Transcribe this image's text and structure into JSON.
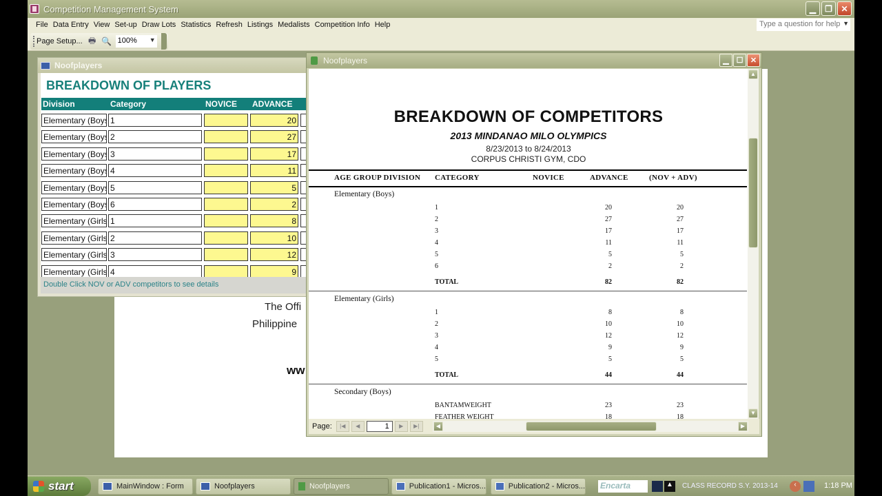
{
  "window": {
    "title": "Competition Management System",
    "controls": [
      "minimize",
      "restore",
      "close"
    ]
  },
  "menu": {
    "items": [
      "File",
      "Data Entry",
      "View",
      "Set-up",
      "Draw Lots",
      "Statistics",
      "Refresh",
      "Listings",
      "Medalists",
      "Competition Info",
      "Help"
    ],
    "help_placeholder": "Type a question for help"
  },
  "toolbar": {
    "page_setup_label": "Page Setup...",
    "zoom_value": "100%"
  },
  "background_page": {
    "line1": "The Offi",
    "line2": "Philippine",
    "line3": "ww"
  },
  "form_window": {
    "title": "Noofplayers",
    "heading": "BREAKDOWN OF PLAYERS",
    "columns": [
      "Division",
      "Category",
      "NOVICE",
      "ADVANCE"
    ],
    "rows": [
      {
        "division": "Elementary (Boys)",
        "category": "1",
        "novice": "",
        "advance": "20"
      },
      {
        "division": "Elementary (Boys)",
        "category": "2",
        "novice": "",
        "advance": "27"
      },
      {
        "division": "Elementary (Boys)",
        "category": "3",
        "novice": "",
        "advance": "17"
      },
      {
        "division": "Elementary (Boys)",
        "category": "4",
        "novice": "",
        "advance": "11"
      },
      {
        "division": "Elementary (Boys)",
        "category": "5",
        "novice": "",
        "advance": "5"
      },
      {
        "division": "Elementary (Boys)",
        "category": "6",
        "novice": "",
        "advance": "2"
      },
      {
        "division": "Elementary (Girls)",
        "category": "1",
        "novice": "",
        "advance": "8"
      },
      {
        "division": "Elementary (Girls)",
        "category": "2",
        "novice": "",
        "advance": "10"
      },
      {
        "division": "Elementary (Girls)",
        "category": "3",
        "novice": "",
        "advance": "12"
      },
      {
        "division": "Elementary (Girls)",
        "category": "4",
        "novice": "",
        "advance": "9"
      }
    ],
    "footer_hint": "Double Click  NOV or ADV competitors  to see details"
  },
  "report_window": {
    "title": "Noofplayers",
    "report_title": "BREAKDOWN OF COMPETITORS",
    "subtitle": "2013 MINDANAO MILO OLYMPICS",
    "date_range": "8/23/2013 to 8/24/2013",
    "venue": "CORPUS CHRISTI GYM, CDO",
    "columns": [
      "AGE GROUP DIVISION",
      "CATEGORY",
      "NOVICE",
      "ADVANCE",
      "(NOV + ADV)"
    ],
    "groups": [
      {
        "name": "Elementary (Boys)",
        "rows": [
          {
            "category": "1",
            "novice": "",
            "advance": "20",
            "total": "20"
          },
          {
            "category": "2",
            "novice": "",
            "advance": "27",
            "total": "27"
          },
          {
            "category": "3",
            "novice": "",
            "advance": "17",
            "total": "17"
          },
          {
            "category": "4",
            "novice": "",
            "advance": "11",
            "total": "11"
          },
          {
            "category": "5",
            "novice": "",
            "advance": "5",
            "total": "5"
          },
          {
            "category": "6",
            "novice": "",
            "advance": "2",
            "total": "2"
          }
        ],
        "total_label": "TOTAL",
        "total_advance": "82",
        "total_all": "82"
      },
      {
        "name": "Elementary (Girls)",
        "rows": [
          {
            "category": "1",
            "novice": "",
            "advance": "8",
            "total": "8"
          },
          {
            "category": "2",
            "novice": "",
            "advance": "10",
            "total": "10"
          },
          {
            "category": "3",
            "novice": "",
            "advance": "12",
            "total": "12"
          },
          {
            "category": "4",
            "novice": "",
            "advance": "9",
            "total": "9"
          },
          {
            "category": "5",
            "novice": "",
            "advance": "5",
            "total": "5"
          }
        ],
        "total_label": "TOTAL",
        "total_advance": "44",
        "total_all": "44"
      },
      {
        "name": "Secondary (Boys)",
        "rows": [
          {
            "category": "BANTAMWEIGHT",
            "novice": "",
            "advance": "23",
            "total": "23"
          },
          {
            "category": "FEATHER WEIGHT",
            "novice": "",
            "advance": "18",
            "total": "18"
          }
        ]
      }
    ],
    "page_label": "Page:",
    "page_number": "1"
  },
  "taskbar": {
    "start_label": "start",
    "tasks": [
      {
        "label": "MainWindow : Form",
        "active": false
      },
      {
        "label": "Noofplayers",
        "active": false
      },
      {
        "label": "Noofplayers",
        "active": true
      },
      {
        "label": "Publication1 - Micros...",
        "active": false
      },
      {
        "label": "Publication2 - Micros...",
        "active": false
      }
    ],
    "encarta_label": "Encarta",
    "tray_text": "CLASS RECORD S.Y. 2013-14",
    "clock": "1:18 PM"
  }
}
